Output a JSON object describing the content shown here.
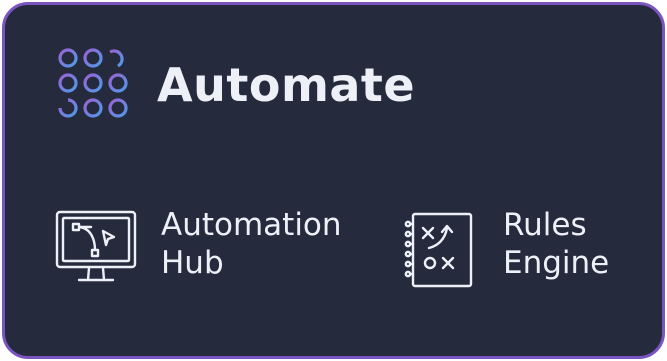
{
  "card": {
    "title": "Automate",
    "logo_icon": "dot-grid-logo-icon",
    "items": [
      {
        "line1": "Automation",
        "line2": "Hub",
        "icon": "monitor-bezier-icon"
      },
      {
        "line1": "Rules",
        "line2": "Engine",
        "icon": "notebook-strategy-icon"
      }
    ]
  },
  "colors": {
    "background": "#262a3d",
    "border": "#7a55c0",
    "text": "#eef0f7",
    "logo_purple": "#8e6cd6",
    "logo_blue": "#5d8ee8"
  }
}
